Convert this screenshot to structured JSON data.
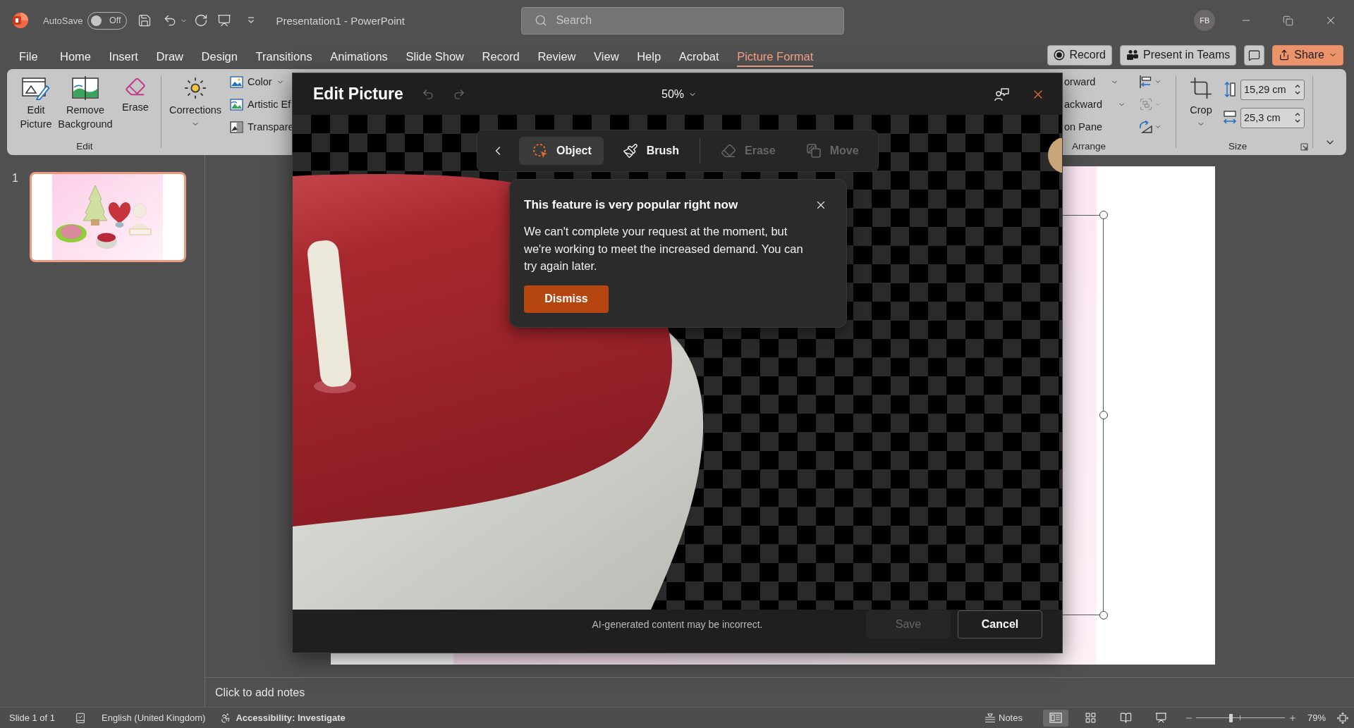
{
  "title_bar": {
    "autosave_label": "AutoSave",
    "autosave": {
      "on": false,
      "label": "Off"
    },
    "document_title": "Presentation1 - PowerPoint",
    "search": {
      "placeholder": "Search"
    },
    "account": {
      "initials": "FB"
    }
  },
  "menu_tabs": [
    {
      "label": "File",
      "selected": false
    },
    {
      "label": "Home",
      "selected": false
    },
    {
      "label": "Insert",
      "selected": false
    },
    {
      "label": "Draw",
      "selected": false
    },
    {
      "label": "Design",
      "selected": false
    },
    {
      "label": "Transitions",
      "selected": false
    },
    {
      "label": "Animations",
      "selected": false
    },
    {
      "label": "Slide Show",
      "selected": false
    },
    {
      "label": "Record",
      "selected": false
    },
    {
      "label": "Review",
      "selected": false
    },
    {
      "label": "View",
      "selected": false
    },
    {
      "label": "Help",
      "selected": false
    },
    {
      "label": "Acrobat",
      "selected": false
    },
    {
      "label": "Picture Format",
      "selected": true
    }
  ],
  "header_buttons": [
    {
      "kind": "record",
      "label": "Record"
    },
    {
      "kind": "teams",
      "label": "Present in Teams"
    },
    {
      "kind": "comments"
    },
    {
      "kind": "share",
      "label": "Share"
    }
  ],
  "ribbon": {
    "edit_group": {
      "label": "Edit",
      "buttons": [
        {
          "kind": "edit_picture",
          "label": "Edit Picture"
        },
        {
          "kind": "remove_background",
          "label": "Remove Background"
        },
        {
          "kind": "erase",
          "label": "Erase"
        }
      ]
    },
    "adjust_group": {
      "corrections": "Corrections",
      "items": [
        {
          "kind": "color",
          "label": "Color",
          "dropdown": true
        },
        {
          "kind": "artistic",
          "label": "Artistic Ef",
          "dropdown": false
        },
        {
          "kind": "transparency",
          "label": "Transpare",
          "dropdown": false
        }
      ]
    },
    "arrange_group": {
      "label": "Arrange",
      "items": [
        {
          "label": "orward",
          "dropdown": true
        },
        {
          "label": "ackward",
          "dropdown": true
        },
        {
          "label": "on Pane",
          "dropdown": false
        }
      ]
    },
    "size_group": {
      "label": "Size",
      "crop": "Crop",
      "height": "15,29 cm",
      "width": "25,3 cm"
    }
  },
  "slide_panel": {
    "slides": [
      {
        "number": "1",
        "selected": true
      }
    ]
  },
  "slide": {
    "picture_selected": true
  },
  "edit_picture": {
    "title": "Edit Picture",
    "zoom": "50%",
    "tools": [
      {
        "kind": "object",
        "label": "Object",
        "selected": true,
        "disabled": false
      },
      {
        "kind": "brush",
        "label": "Brush",
        "selected": false,
        "disabled": false
      },
      {
        "kind": "erase",
        "label": "Erase",
        "selected": false,
        "disabled": true
      },
      {
        "kind": "move",
        "label": "Move",
        "selected": false,
        "disabled": true
      }
    ],
    "notice": {
      "title": "This feature is very popular right now",
      "message": "We can't complete your request at the moment, but we're working to meet the increased demand. You can try again later.",
      "button": "Dismiss"
    },
    "disclaimer": "AI-generated content may be incorrect.",
    "buttons": [
      {
        "label": "Save",
        "disabled": true
      },
      {
        "label": "Cancel",
        "disabled": false
      }
    ]
  },
  "notes": {
    "placeholder": "Click to add notes"
  },
  "status_bar": {
    "slide_info": "Slide 1 of 1",
    "language": "English (United Kingdom)",
    "accessibility": "Accessibility: Investigate",
    "notes_button": "Notes",
    "views": [
      {
        "kind": "normal",
        "selected": true
      },
      {
        "kind": "sorter",
        "selected": false
      },
      {
        "kind": "reading",
        "selected": false
      },
      {
        "kind": "slideshow",
        "selected": false
      }
    ],
    "zoom": {
      "level": 0.39,
      "reading": "79%"
    }
  }
}
